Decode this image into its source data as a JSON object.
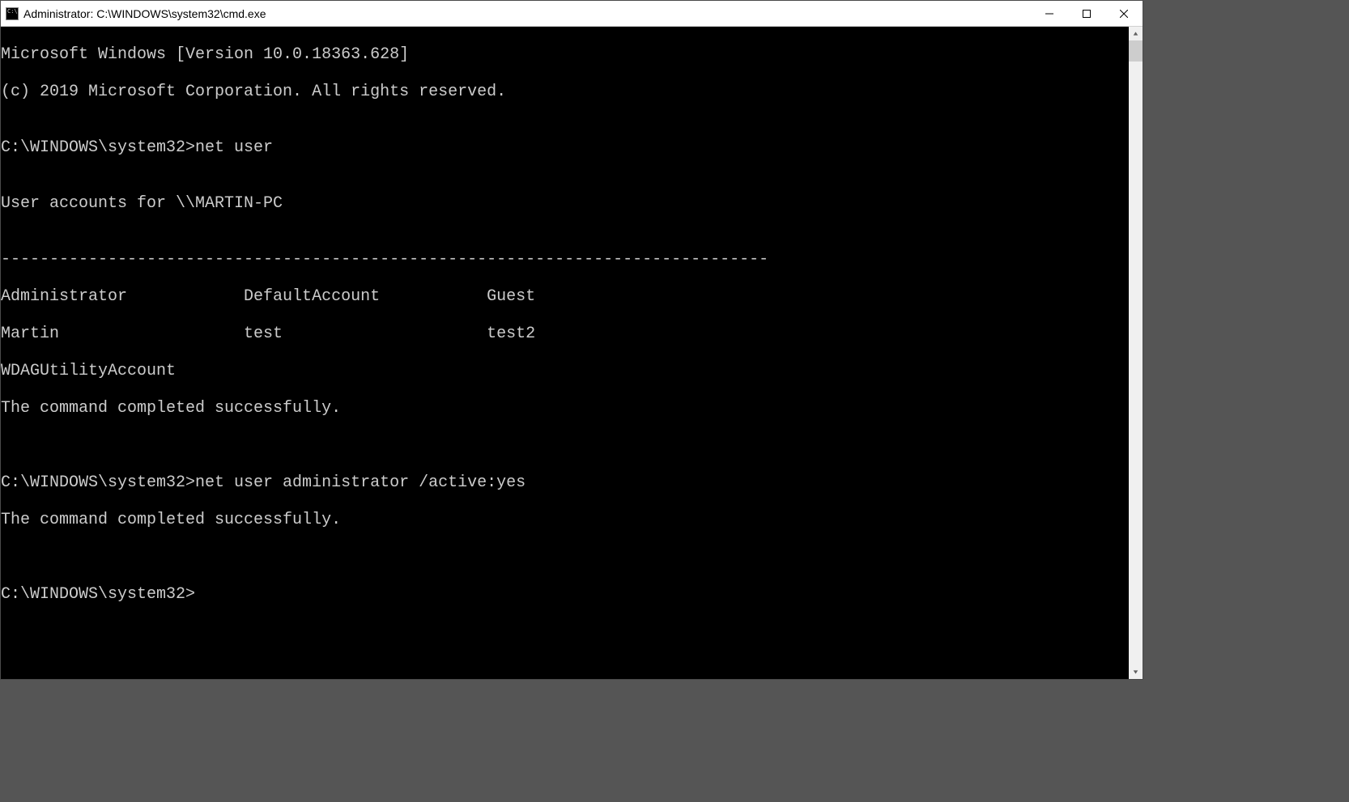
{
  "titlebar": {
    "title": "Administrator: C:\\WINDOWS\\system32\\cmd.exe"
  },
  "console": {
    "header_line1": "Microsoft Windows [Version 10.0.18363.628]",
    "header_line2": "(c) 2019 Microsoft Corporation. All rights reserved.",
    "blank": "",
    "prompt1": "C:\\WINDOWS\\system32>net user",
    "accounts_header": "User accounts for \\\\MARTIN-PC",
    "divider": "-------------------------------------------------------------------------------",
    "accounts_row1": "Administrator            DefaultAccount           Guest",
    "accounts_row2": "Martin                   test                     test2",
    "accounts_row3": "WDAGUtilityAccount",
    "complete1": "The command completed successfully.",
    "prompt2": "C:\\WINDOWS\\system32>net user administrator /active:yes",
    "complete2": "The command completed successfully.",
    "prompt3": "C:\\WINDOWS\\system32>"
  },
  "accounts": {
    "host": "MARTIN-PC",
    "users": [
      "Administrator",
      "DefaultAccount",
      "Guest",
      "Martin",
      "test",
      "test2",
      "WDAGUtilityAccount"
    ]
  }
}
